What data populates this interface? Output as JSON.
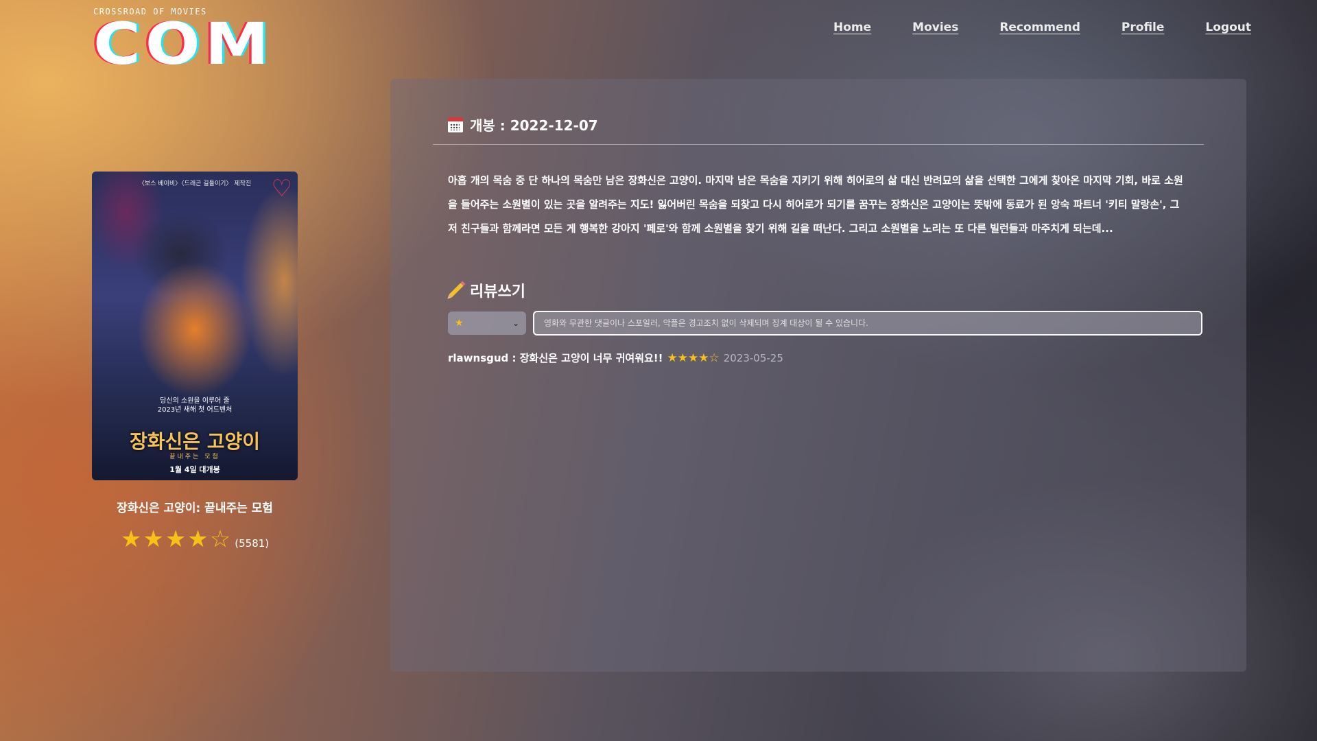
{
  "logo": {
    "subtitle": "CROSSROAD OF MOVIES",
    "text": "COM"
  },
  "nav": [
    {
      "label": "Home"
    },
    {
      "label": "Movies"
    },
    {
      "label": "Recommend"
    },
    {
      "label": "Profile"
    },
    {
      "label": "Logout"
    }
  ],
  "movie": {
    "title": "장화신은 고양이: 끝내주는 모험",
    "rating_stars": 4,
    "rating_max": 5,
    "rating_count": "(5581)",
    "poster": {
      "top_text": "〈보스 베이비〉〈드래곤 길들이기〉 제작진",
      "tagline_1": "당신의 소원을 이루어 줄",
      "tagline_2": "2023년 새해 첫 어드벤처",
      "title": "장화신은 고양이",
      "subtitle": "끝내주는 모험",
      "release_note": "1월 4일 대개봉"
    }
  },
  "details": {
    "release_label": "개봉 : 2022-12-07",
    "overview": "아홉 개의 목숨 중 단 하나의 목숨만 남은 장화신은 고양이. 마지막 남은 목숨을 지키기 위해 히어로의 삶 대신 반려묘의 삶을 선택한 그에게 찾아온 마지막 기회, 바로 소원을 들어주는 소원별이 있는 곳을 알려주는 지도! 잃어버린 목숨을 되찾고 다시 히어로가 되기를 꿈꾸는 장화신은 고양이는 뜻밖에 동료가 된 앙숙 파트너 '키티 말랑손', 그저 친구들과 함께라면 모든 게 행복한 강아지 '페로'와 함께 소원별을 찾기 위해 길을 떠난다. 그리고 소원별을 노리는 또 다른 빌런들과 마주치게 되는데..."
  },
  "review_form": {
    "heading": "리뷰쓰기",
    "rating_selected": "★",
    "placeholder": "영화와 무관한 댓글이나 스포일러, 악플은 경고조치 없이 삭제되며 징계 대상이 될 수 있습니다."
  },
  "reviews": [
    {
      "text": "rlawnsgud : 장화신은 고양이 너무 귀여워요!!",
      "stars": "★★★★☆",
      "date": "2023-05-25"
    }
  ],
  "colors": {
    "star": "#f7c01a",
    "calendar_red": "#d8383c"
  },
  "icons": {
    "release": "calendar-icon",
    "review": "pencil-icon",
    "favorite": "heart-icon"
  }
}
